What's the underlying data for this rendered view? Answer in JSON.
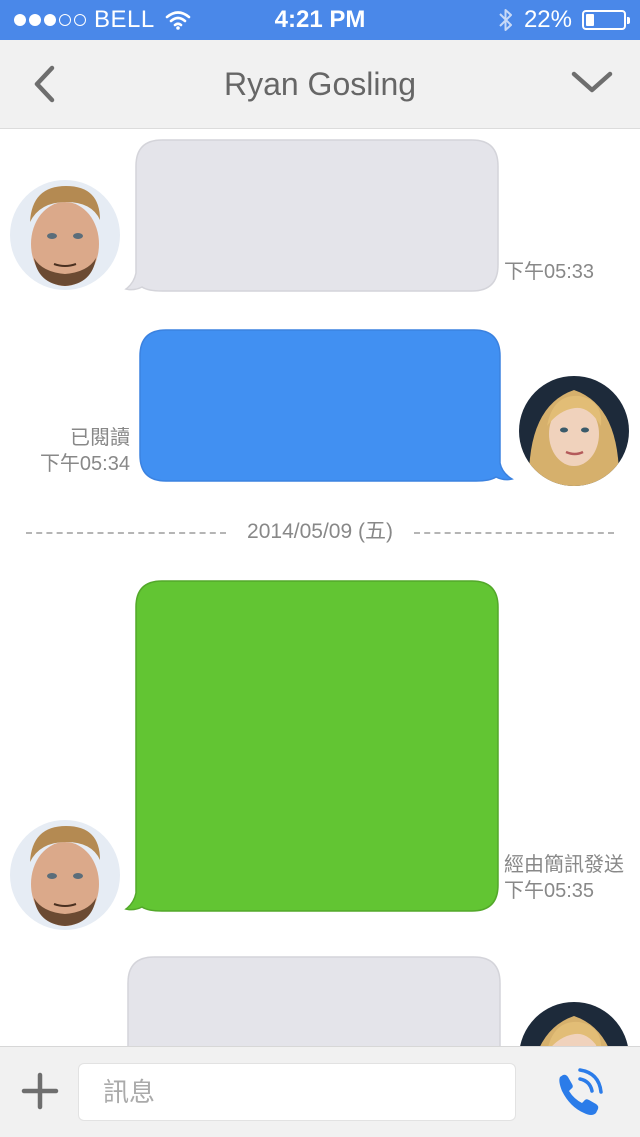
{
  "status_bar": {
    "carrier": "BELL",
    "signal_bars_filled": 3,
    "signal_bars_total": 5,
    "time": "4:21 PM",
    "battery_percent_label": "22%",
    "battery_level": 0.22
  },
  "header": {
    "title": "Ryan Gosling",
    "back_icon": "chevron-left-icon",
    "more_icon": "chevron-down-icon"
  },
  "messages": [
    {
      "sender": "contact",
      "color": "#e4e4ea",
      "time": "下午05:33",
      "status": ""
    },
    {
      "sender": "me",
      "color": "#4190f2",
      "time": "下午05:34",
      "status": "已閱讀"
    },
    {
      "sender": "contact",
      "color": "#62c533",
      "time": "下午05:35",
      "status": "經由簡訊發送"
    },
    {
      "sender": "me",
      "color": "#e4e4ea",
      "time": "",
      "status": ""
    }
  ],
  "date_divider": "2014/05/09 (五)",
  "input_bar": {
    "placeholder": "訊息",
    "value": "",
    "add_icon": "plus-icon",
    "call_icon": "phone-call-icon"
  },
  "colors": {
    "status_bar": "#4a88e9",
    "accent": "#2b7ce9"
  }
}
